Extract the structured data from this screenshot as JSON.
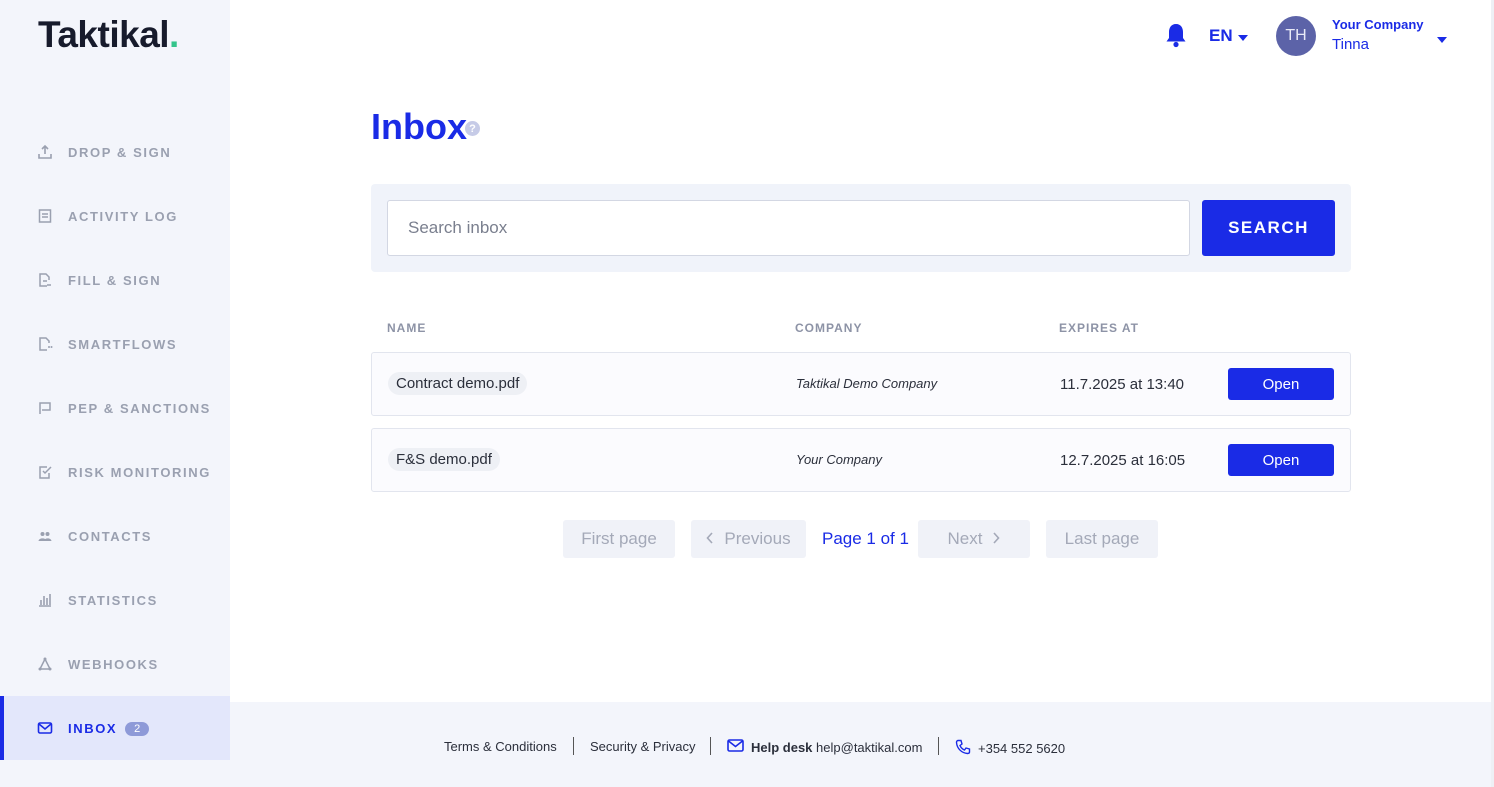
{
  "brand": {
    "name": "Taktikal",
    "dot": "."
  },
  "sidebar": {
    "items": [
      {
        "label": "DROP & SIGN",
        "icon": "upload-icon"
      },
      {
        "label": "ACTIVITY LOG",
        "icon": "document-list-icon"
      },
      {
        "label": "FILL & SIGN",
        "icon": "document-edit-icon"
      },
      {
        "label": "SMARTFLOWS",
        "icon": "document-flow-icon"
      },
      {
        "label": "PEP & SANCTIONS",
        "icon": "flag-icon"
      },
      {
        "label": "RISK MONITORING",
        "icon": "checklist-icon"
      },
      {
        "label": "CONTACTS",
        "icon": "people-icon"
      },
      {
        "label": "STATISTICS",
        "icon": "bar-chart-icon"
      },
      {
        "label": "WEBHOOKS",
        "icon": "webhook-icon"
      },
      {
        "label": "INBOX",
        "icon": "mail-icon",
        "badge": "2",
        "active": true
      }
    ]
  },
  "header": {
    "language": "EN",
    "avatar_initials": "TH",
    "company": "Your Company",
    "user": "Tinna"
  },
  "main": {
    "title": "Inbox",
    "help": "?",
    "search": {
      "placeholder": "Search inbox",
      "button": "SEARCH"
    },
    "table": {
      "columns": [
        "NAME",
        "COMPANY",
        "EXPIRES AT"
      ],
      "rows": [
        {
          "name": "Contract demo.pdf",
          "company": "Taktikal Demo Company",
          "expires": "11.7.2025 at 13:40",
          "action": "Open"
        },
        {
          "name": "F&S demo.pdf",
          "company": "Your Company",
          "expires": "12.7.2025 at 16:05",
          "action": "Open"
        }
      ]
    },
    "pagination": {
      "first": "First page",
      "previous": "Previous",
      "current": "Page 1 of 1",
      "next": "Next",
      "last": "Last page"
    }
  },
  "footer": {
    "terms": "Terms & Conditions",
    "privacy": "Security & Privacy",
    "helpdesk_label": "Help desk",
    "helpdesk_email": "help@taktikal.com",
    "phone": "+354 552 5620"
  },
  "colors": {
    "accent": "#1a2be6",
    "brand_dot": "#34c48b",
    "sidebar_bg": "#f3f5fb"
  }
}
